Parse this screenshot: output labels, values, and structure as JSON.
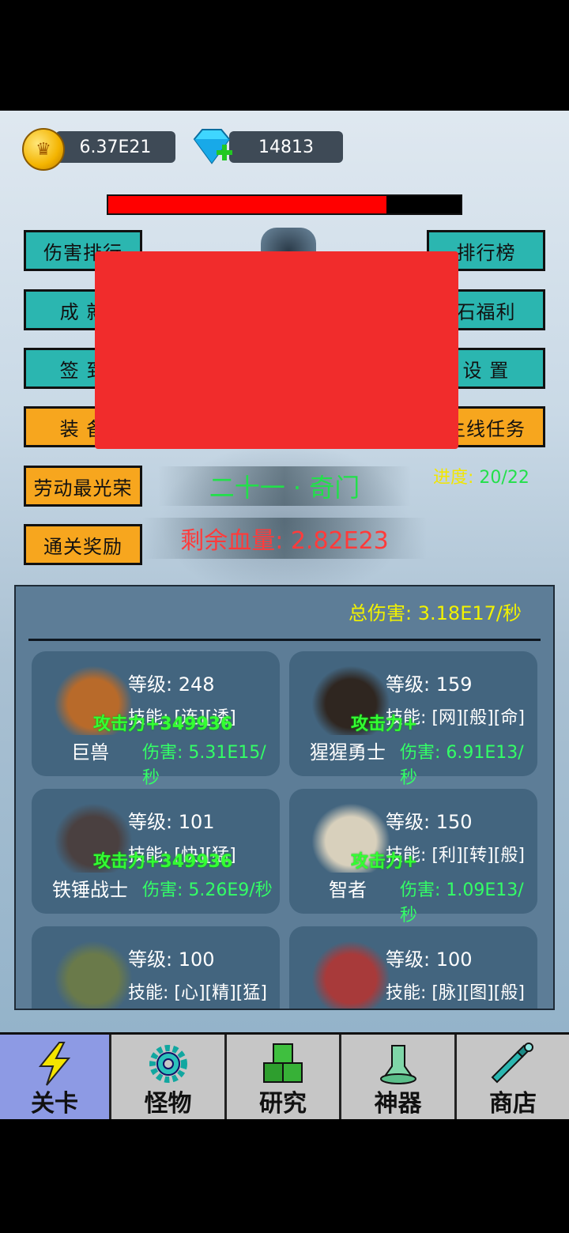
{
  "resources": {
    "gold_value": "6.37E21",
    "gem_value": "14813"
  },
  "boss": {
    "hp_fraction": 0.79
  },
  "left_buttons": [
    {
      "label": "伤害排行",
      "style": "teal"
    },
    {
      "label": "成  就",
      "style": "teal"
    },
    {
      "label": "签  到",
      "style": "teal"
    },
    {
      "label": "装  备",
      "style": "orange"
    },
    {
      "label": "劳动最光荣",
      "style": "orange"
    },
    {
      "label": "通关奖励",
      "style": "orange"
    }
  ],
  "right_buttons": [
    {
      "label": "排行榜",
      "style": "teal"
    },
    {
      "label": "石福利",
      "style": "teal"
    },
    {
      "label": "设  置",
      "style": "teal"
    },
    {
      "label": "主线任务",
      "style": "orange"
    }
  ],
  "stage": {
    "name": "二十一 · 奇门",
    "progress_label": "进度:",
    "progress_value": "20/22",
    "remaining_hp": "剩余血量: 2.82E23"
  },
  "panel": {
    "total_damage": "总伤害: 3.18E17/秒",
    "monsters": [
      {
        "name": "巨兽",
        "level": "等级: 248",
        "skill": "技能: [连][诱]",
        "overlay": "攻击力+349936",
        "damage": "伤害: 5.31E15/秒",
        "color": "#b86a2a"
      },
      {
        "name": "猩猩勇士",
        "level": "等级: 159",
        "skill": "技能: [网][般][命]",
        "overlay": "攻击力+",
        "damage": "伤害: 6.91E13/秒",
        "color": "#2f2620"
      },
      {
        "name": "铁锤战士",
        "level": "等级: 101",
        "skill": "技能: [快][猛]",
        "overlay": "攻击力+349936",
        "damage": "伤害: 5.26E9/秒",
        "color": "#4a4040"
      },
      {
        "name": "智者",
        "level": "等级: 150",
        "skill": "技能: [利][转][般]",
        "overlay": "攻击力+",
        "damage": "伤害: 1.09E13/秒",
        "color": "#d8d0bc"
      },
      {
        "name": "",
        "level": "等级: 100",
        "skill": "技能: [心][精][猛]",
        "overlay": "",
        "damage": "",
        "color": "#6a7a4a"
      },
      {
        "name": "",
        "level": "等级: 100",
        "skill": "技能: [脉][图][般]",
        "overlay": "",
        "damage": "",
        "color": "#a83a3a"
      }
    ]
  },
  "tabs": [
    {
      "label": "关卡",
      "icon": "lightning-icon",
      "active": true
    },
    {
      "label": "怪物",
      "icon": "gear-icon",
      "active": false
    },
    {
      "label": "研究",
      "icon": "blocks-icon",
      "active": false
    },
    {
      "label": "神器",
      "icon": "bell-icon",
      "active": false
    },
    {
      "label": "商店",
      "icon": "bottle-icon",
      "active": false
    }
  ]
}
